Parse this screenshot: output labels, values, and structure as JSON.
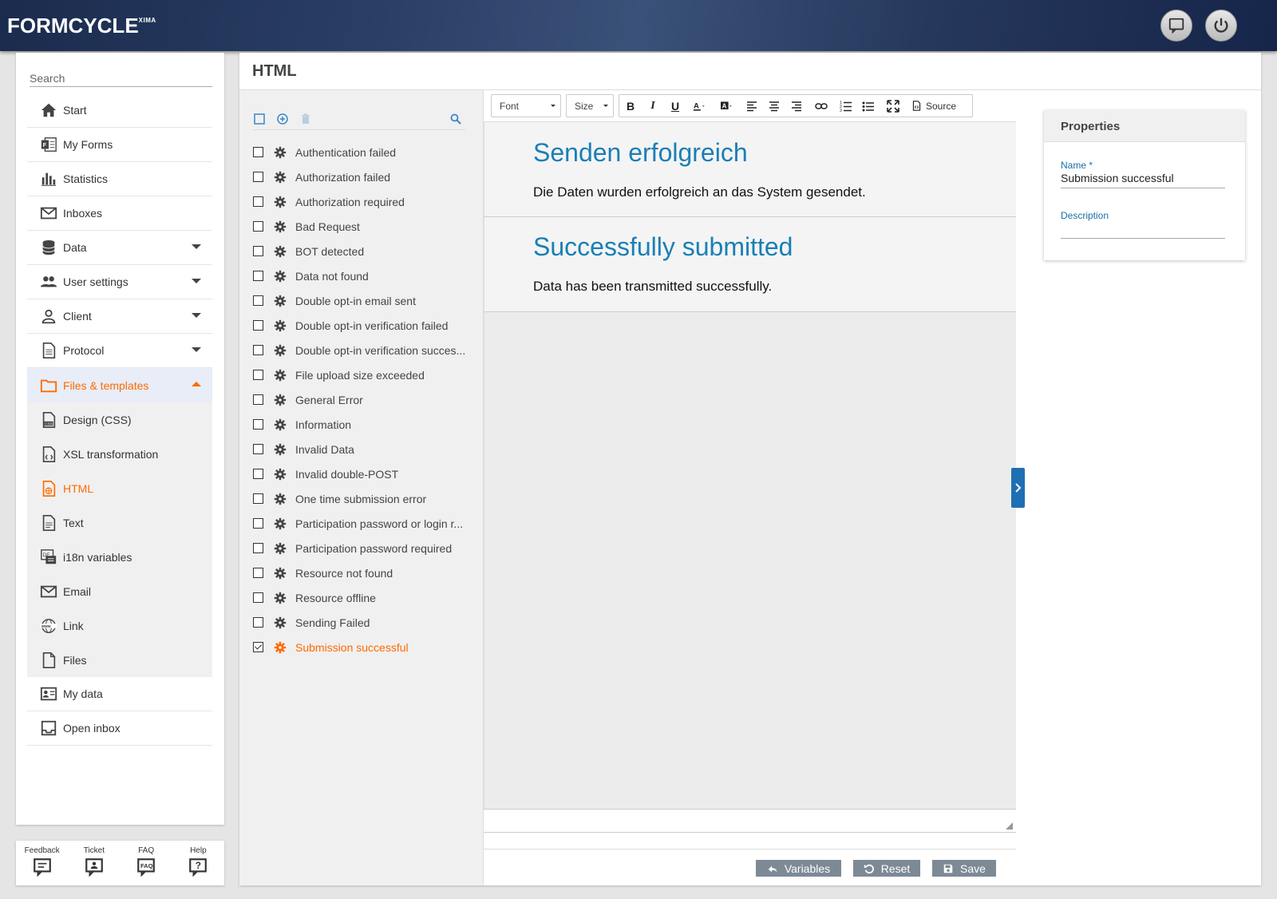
{
  "header": {
    "logo": "FORMCYCLE",
    "logo_sup": "XIMA",
    "feedback_icon": "chat-bubble-icon",
    "logout_icon": "power-icon"
  },
  "sidebar": {
    "search_placeholder": "Search",
    "items": [
      {
        "label": "Start",
        "icon": "home-icon"
      },
      {
        "label": "My Forms",
        "icon": "forms-icon"
      },
      {
        "label": "Statistics",
        "icon": "bar-chart-icon"
      },
      {
        "label": "Inboxes",
        "icon": "envelope-icon"
      },
      {
        "label": "Data",
        "icon": "database-icon"
      },
      {
        "label": "User settings",
        "icon": "users-icon"
      },
      {
        "label": "Client",
        "icon": "user-icon"
      },
      {
        "label": "Protocol",
        "icon": "document-icon"
      },
      {
        "label": "Files & templates",
        "icon": "folder-icon"
      }
    ],
    "subitems": [
      {
        "label": "Design (CSS)",
        "icon": "css-file-icon"
      },
      {
        "label": "XSL transformation",
        "icon": "xsl-file-icon"
      },
      {
        "label": "HTML",
        "icon": "html-file-icon"
      },
      {
        "label": "Text",
        "icon": "text-file-icon"
      },
      {
        "label": "i18n variables",
        "icon": "i18n-icon"
      },
      {
        "label": "Email",
        "icon": "envelope-icon"
      },
      {
        "label": "Link",
        "icon": "globe-icon"
      },
      {
        "label": "Files",
        "icon": "file-icon"
      }
    ],
    "bottom_items": [
      {
        "label": "My data",
        "icon": "id-card-icon"
      },
      {
        "label": "Open inbox",
        "icon": "inbox-icon"
      }
    ]
  },
  "tools": [
    {
      "label": "Feedback",
      "icon": "feedback-icon"
    },
    {
      "label": "Ticket",
      "icon": "ticket-icon"
    },
    {
      "label": "FAQ",
      "icon": "faq-icon"
    },
    {
      "label": "Help",
      "icon": "help-icon"
    }
  ],
  "main": {
    "title": "HTML"
  },
  "list": {
    "items": [
      "Authentication failed",
      "Authorization failed",
      "Authorization required",
      "Bad Request",
      "BOT detected",
      "Data not found",
      "Double opt-in email sent",
      "Double opt-in verification failed",
      "Double opt-in verification succes...",
      "File upload size exceeded",
      "General Error",
      "Information",
      "Invalid Data",
      "Invalid double-POST",
      "One time submission error",
      "Participation password or login r...",
      "Participation password required",
      "Resource not found",
      "Resource offline",
      "Sending Failed",
      "Submission successful"
    ],
    "selected_index": 20
  },
  "editor": {
    "font_label": "Font",
    "size_label": "Size",
    "source_label": "Source",
    "blocks": [
      {
        "heading": "Senden erfolgreich",
        "text": "Die Daten wurden erfolgreich an das System gesendet."
      },
      {
        "heading": "Successfully submitted",
        "text": "Data has been transmitted successfully."
      }
    ],
    "buttons": {
      "variables": "Variables",
      "reset": "Reset",
      "save": "Save"
    }
  },
  "properties": {
    "title": "Properties",
    "name_label": "Name *",
    "name_value": "Submission successful",
    "description_label": "Description",
    "description_value": ""
  },
  "colors": {
    "accent": "#ff6a00",
    "link_blue": "#1a7fb5",
    "button_gray": "#7d8a96"
  }
}
